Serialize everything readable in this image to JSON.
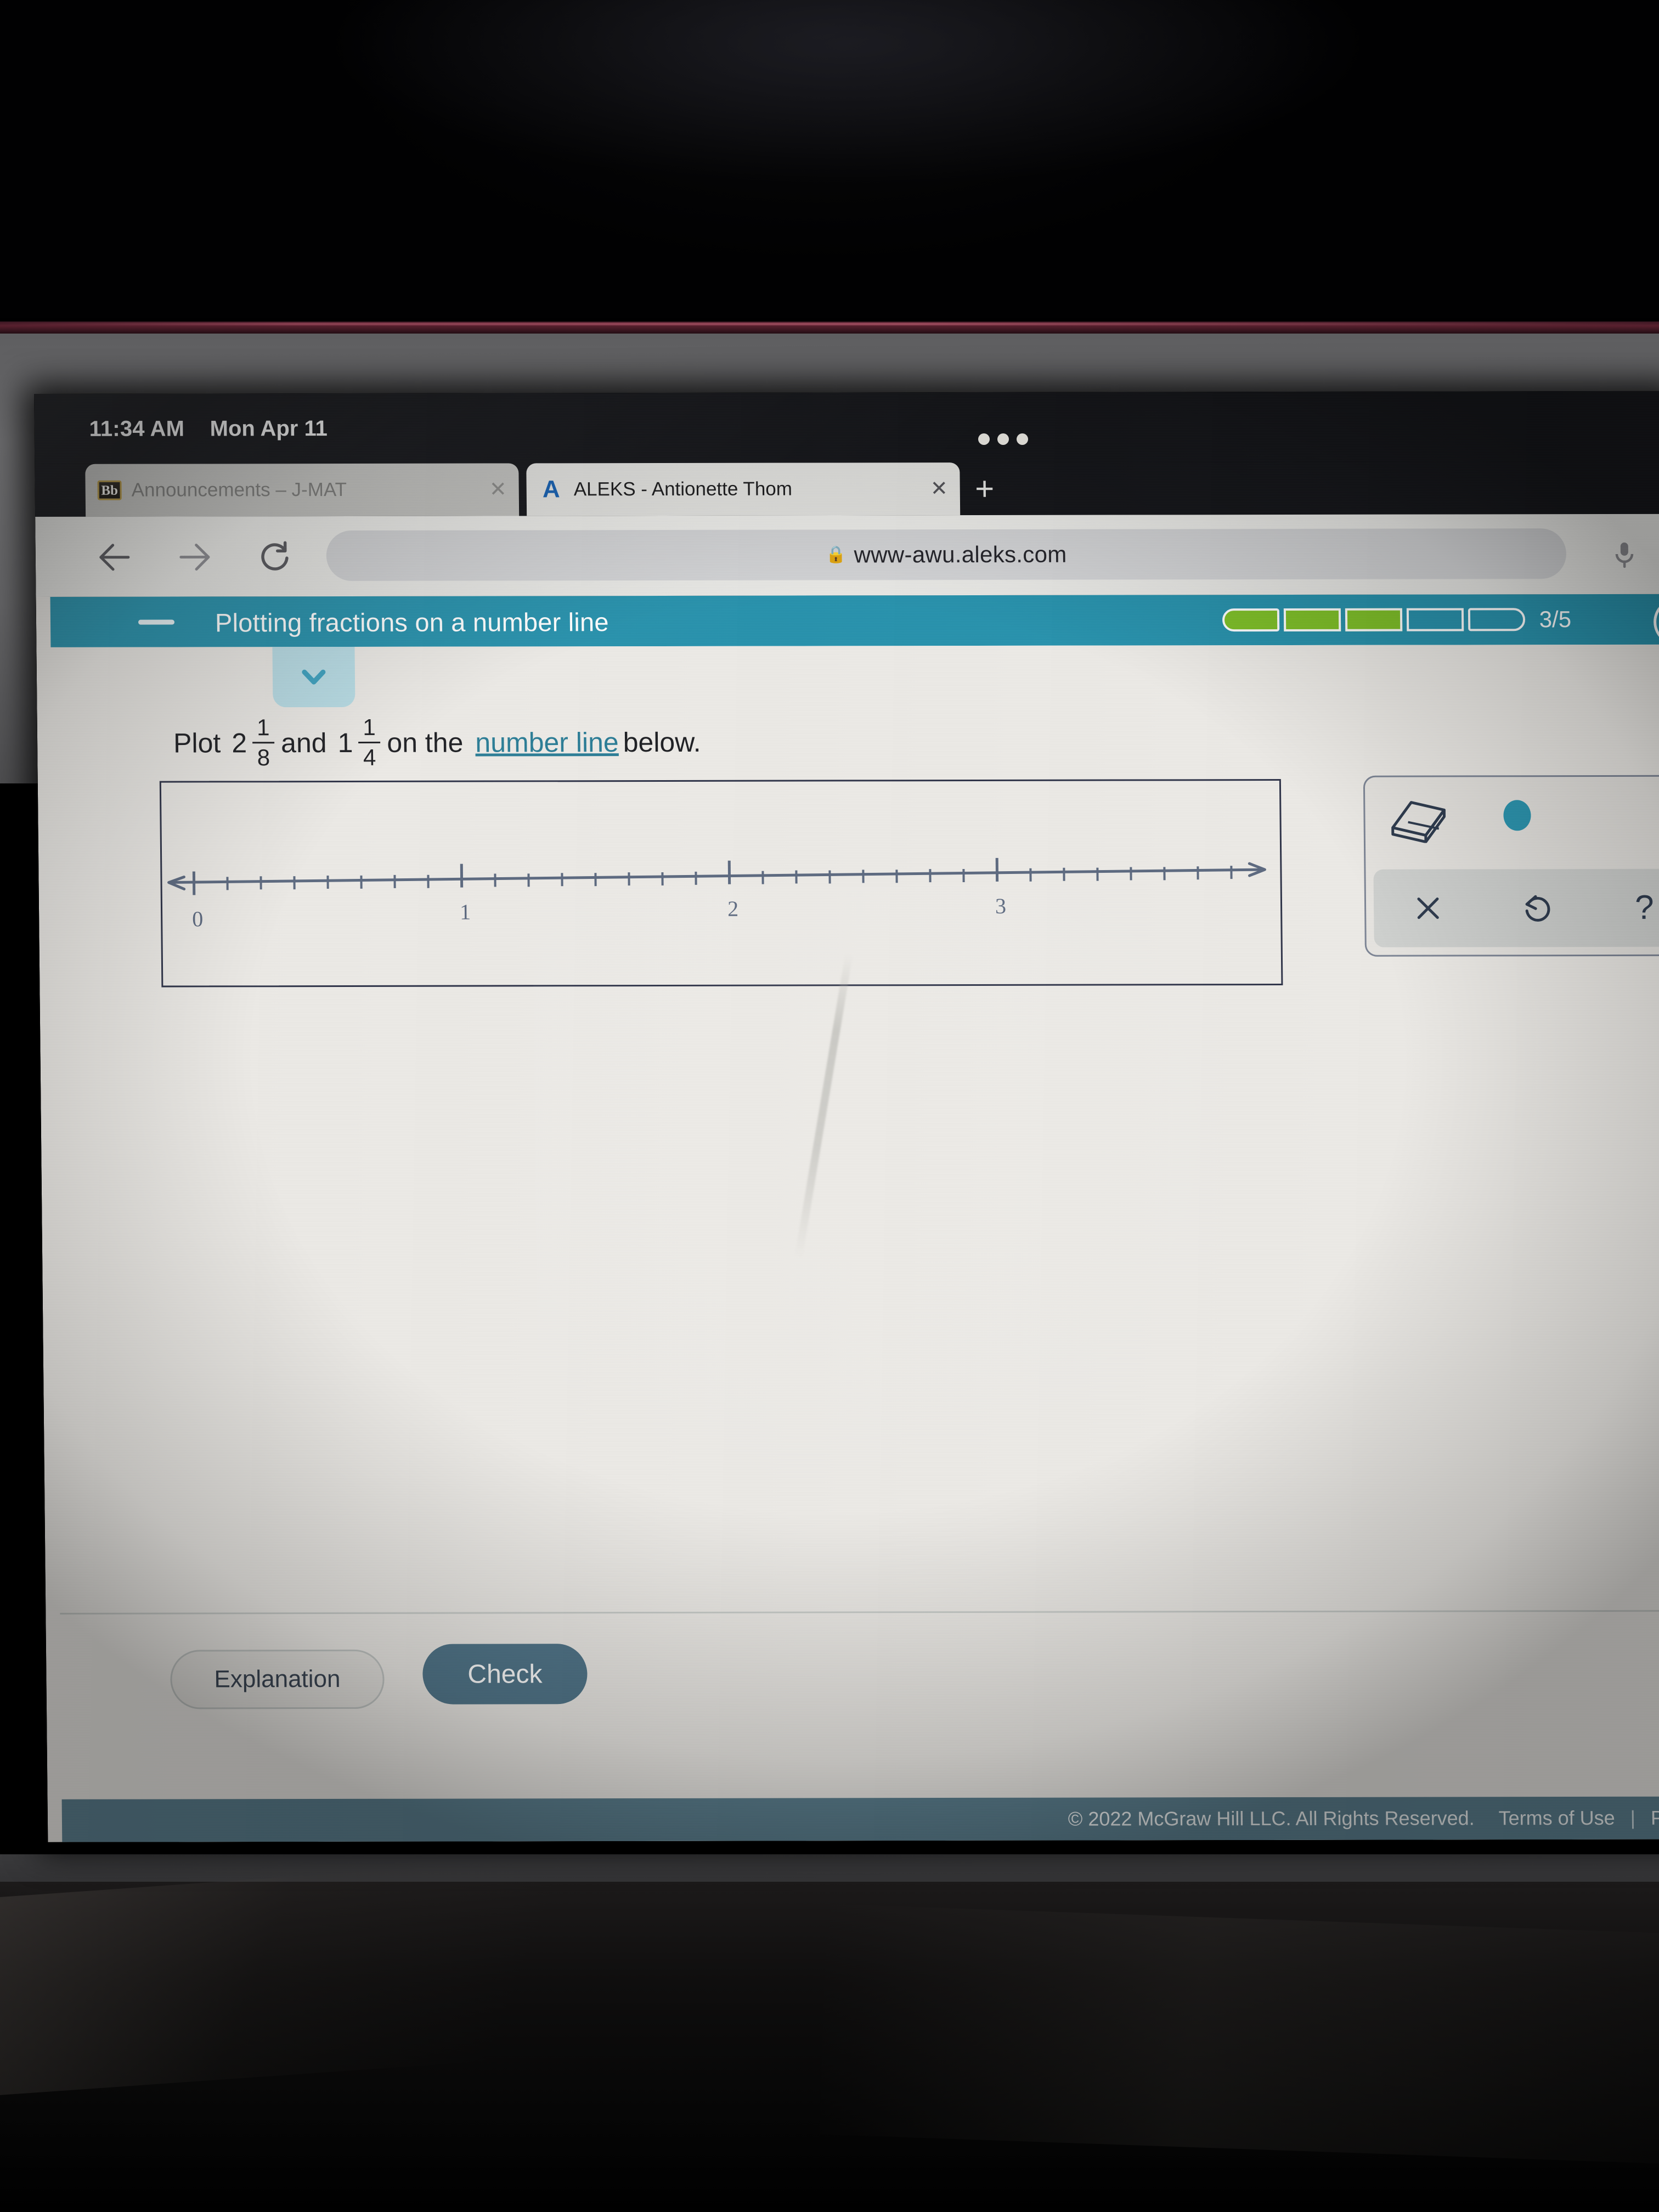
{
  "device": {
    "status_bar": {
      "time": "11:34 AM",
      "date": "Mon Apr 11",
      "multitask_icon": "three-dots-icon"
    }
  },
  "browser": {
    "tabs": [
      {
        "favicon": "blackboard-favicon",
        "favicon_text": "Bb",
        "title": "Announcements – J-MAT",
        "close_label": "✕",
        "active": false
      },
      {
        "favicon": "aleks-favicon",
        "favicon_text": "A",
        "title": "ALEKS - Antionette Thom",
        "close_label": "✕",
        "active": true
      }
    ],
    "new_tab_label": "+",
    "toolbar": {
      "back_icon": "arrow-left-icon",
      "forward_icon": "arrow-right-icon",
      "reload_icon": "reload-icon",
      "back_label": "←",
      "forward_label": "→",
      "reload_label": "⟳",
      "lock_icon": "lock-icon",
      "url": "www-awu.aleks.com",
      "mic_icon": "microphone-icon"
    }
  },
  "aleks": {
    "header": {
      "menu_icon": "hamburger-icon",
      "title": "Plotting fractions on a number line",
      "progress": {
        "completed": 3,
        "total": 5,
        "label": "3/5",
        "segments": [
          true,
          true,
          true,
          false,
          false
        ],
        "filled_color": "#7fc028",
        "bar_color": "#2892ad"
      }
    },
    "collapse_toggle": {
      "icon": "chevron-down-icon",
      "label": "Collapse"
    },
    "question": {
      "prefix": "Plot",
      "mixed_a": {
        "whole": "2",
        "numerator": "1",
        "denominator": "8"
      },
      "conjunction": "and",
      "mixed_b": {
        "whole": "1",
        "numerator": "1",
        "denominator": "4"
      },
      "middle": "on the",
      "link_text": "number line",
      "suffix": "below."
    },
    "tools": {
      "eraser_icon": "eraser-icon",
      "point_icon": "point-dot-icon",
      "clear_icon": "close-x-icon",
      "undo_icon": "undo-icon",
      "help_icon": "question-mark-icon",
      "clear_label": "✕",
      "undo_label": "↺",
      "help_label": "?"
    },
    "actions": {
      "explanation_label": "Explanation",
      "check_label": "Check"
    },
    "footer": {
      "copyright": "© 2022 McGraw Hill LLC. All Rights Reserved.",
      "terms_label": "Terms of Use",
      "separator": "|",
      "privacy_label": "Priv"
    }
  },
  "chart_data": {
    "type": "line",
    "title": "Number line 0 to 3",
    "xlabel": "",
    "ylabel": "",
    "xlim": [
      0,
      3
    ],
    "major_ticks": [
      0,
      1,
      2,
      3
    ],
    "tick_labels": [
      "0",
      "1",
      "2",
      "3"
    ],
    "minor_subdivisions": 8,
    "minor_tick_step": 0.125,
    "arrow_left": true,
    "arrow_right": true,
    "plotted_points": [],
    "target_points": [
      2.125,
      1.25
    ],
    "grid": false,
    "legend": false,
    "line_color": "#5d6a80"
  },
  "colors": {
    "accent_teal": "#2892ad",
    "progress_green": "#7fc028",
    "check_button": "#51768a",
    "footer_bar": "#5c8090",
    "link": "#2b7d96",
    "page_bg": "#eceae6"
  }
}
